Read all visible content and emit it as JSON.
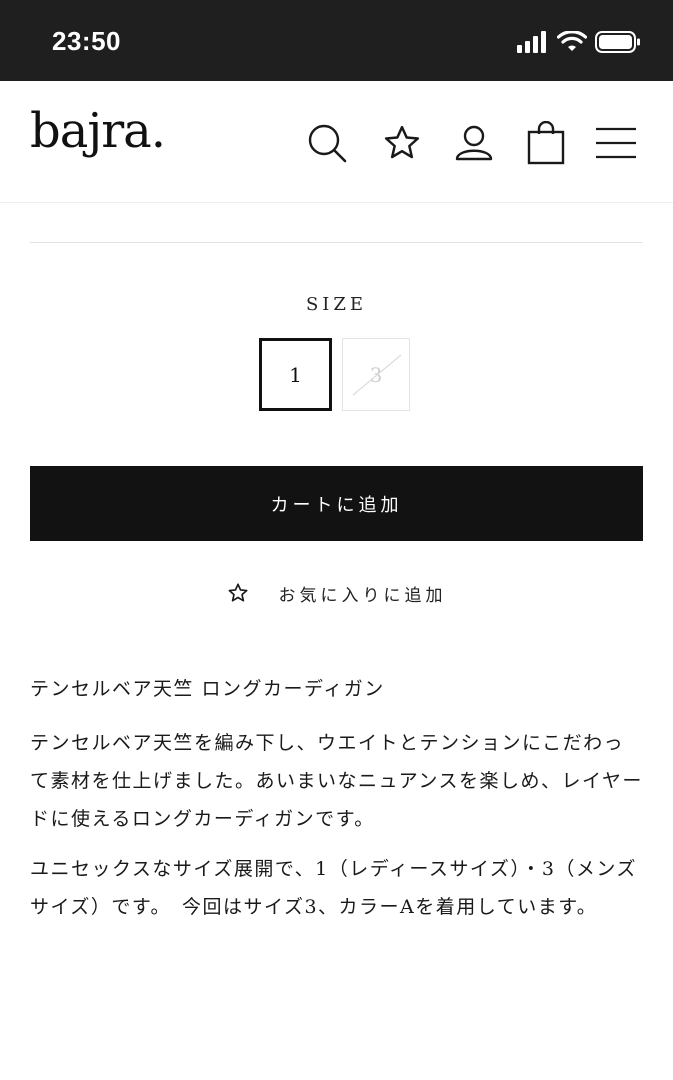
{
  "status_bar": {
    "time": "23:50"
  },
  "header": {
    "logo": "bajra.",
    "icons": [
      "search-icon",
      "star-icon",
      "user-icon",
      "bag-icon",
      "menu-icon"
    ]
  },
  "size": {
    "label": "SIZE",
    "options": [
      {
        "label": "1",
        "state": "selected"
      },
      {
        "label": "3",
        "state": "unavailable"
      }
    ]
  },
  "actions": {
    "add_to_cart": "カートに追加",
    "add_to_favorites": "お気に入りに追加"
  },
  "product": {
    "title": "テンセルベア天竺 ロングカーディガン",
    "description_1": "テンセルベア天竺を編み下し、ウエイトとテンションにこだわって素材を仕上げました。あいまいなニュアンスを楽しめ、レイヤードに使えるロングカーディガンです。",
    "description_2": "ユニセックスなサイズ展開で、1（レディースサイズ）・3（メンズサイズ）です。　今回はサイズ3、カラーAを着用しています。"
  },
  "colors": {
    "button_bg": "#121212",
    "status_bar_bg": "#1f1f1f"
  }
}
